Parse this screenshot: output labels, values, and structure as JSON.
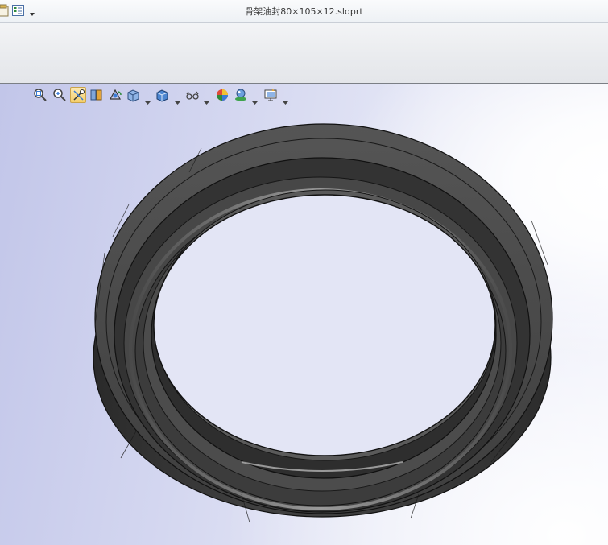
{
  "window": {
    "title": "骨架油封80×105×12.sldprt"
  },
  "quick_access": [
    {
      "icon": "options-icon"
    },
    {
      "icon": "file-properties-icon"
    },
    {
      "icon": "chevron-down-icon"
    }
  ],
  "heads_up_toolbar": [
    {
      "icon": "zoom-to-fit-icon"
    },
    {
      "icon": "zoom-to-area-icon"
    },
    {
      "icon": "previous-view-icon",
      "active": true
    },
    {
      "icon": "section-view-icon"
    },
    {
      "icon": "view-orientation-icon"
    },
    {
      "icon": "display-style-icon"
    },
    {
      "icon": "hide-show-items-icon"
    },
    {
      "icon": "edit-appearance-icon"
    },
    {
      "icon": "apply-scene-icon"
    },
    {
      "icon": "view-settings-icon"
    }
  ],
  "model": {
    "description": "oil seal ring",
    "color": "#3a3a3a"
  },
  "colors": {
    "title_bar": "#eef1f5",
    "command_band": "#e9ebee",
    "viewport_tint": "#c2c6e9",
    "active_tool": "#f5cf6a"
  }
}
